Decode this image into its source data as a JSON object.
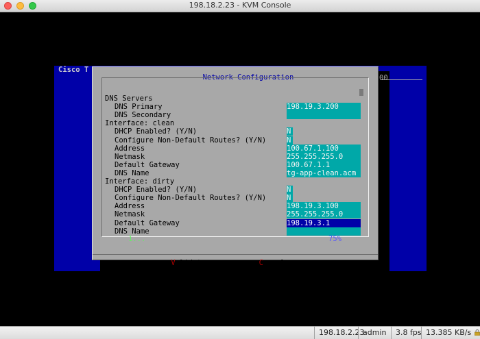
{
  "window": {
    "title": "198.18.2.23 - KVM Console"
  },
  "background": {
    "left_title": "Cisco T",
    "right_fragment": "00"
  },
  "dialog": {
    "title": "Network Configuration",
    "rows": [
      {
        "label": "DNS Servers",
        "indent": 0,
        "value": null
      },
      {
        "label": "DNS Primary",
        "indent": 1,
        "value": "198.19.3.200"
      },
      {
        "label": "DNS Secondary",
        "indent": 1,
        "value": ""
      },
      {
        "label": "Interface: clean",
        "indent": 0,
        "value": null
      },
      {
        "label": "DHCP Enabled? (Y/N)",
        "indent": 1,
        "value": "N",
        "short": true
      },
      {
        "label": "Configure Non-Default Routes? (Y/N)",
        "indent": 1,
        "value": "N",
        "short": true
      },
      {
        "label": "Address",
        "indent": 1,
        "value": "100.67.1.100"
      },
      {
        "label": "Netmask",
        "indent": 1,
        "value": "255.255.255.0"
      },
      {
        "label": "Default Gateway",
        "indent": 1,
        "value": "100.67.1.1"
      },
      {
        "label": "DNS Name",
        "indent": 1,
        "value": "tg-app-clean.acm"
      },
      {
        "label": "Interface: dirty",
        "indent": 0,
        "value": null
      },
      {
        "label": "DHCP Enabled? (Y/N)",
        "indent": 1,
        "value": "N",
        "short": true
      },
      {
        "label": "Configure Non-Default Routes? (Y/N)",
        "indent": 1,
        "value": "N",
        "short": true
      },
      {
        "label": "Address",
        "indent": 1,
        "value": "198.19.3.100"
      },
      {
        "label": "Netmask",
        "indent": 1,
        "value": "255.255.255.0"
      },
      {
        "label": "Default Gateway",
        "indent": 1,
        "value": "198.19.3.1",
        "active": true
      },
      {
        "label": "DNS Name",
        "indent": 1,
        "value": ""
      }
    ],
    "status_left": "1...",
    "scroll_percent": "75%",
    "buttons": {
      "validate": {
        "left": "<",
        "hot": "V",
        "rest": "alidate",
        "right": ">"
      },
      "cancel": {
        "left": "< ",
        "hot": "C",
        "rest": "ancel",
        "right": " >"
      }
    }
  },
  "statusbar": {
    "host": "198.18.2.23",
    "user": "admin",
    "fps": "3.8 fps",
    "rate": "13.385 KB/s"
  },
  "colors": {
    "console_bg": "#000000",
    "dialog_bg": "#a8a8a8",
    "field_bg": "#00a8a8",
    "active_field_bg": "#0000a8",
    "panel_blue": "#0000a8",
    "hotkey": "#a80000"
  }
}
